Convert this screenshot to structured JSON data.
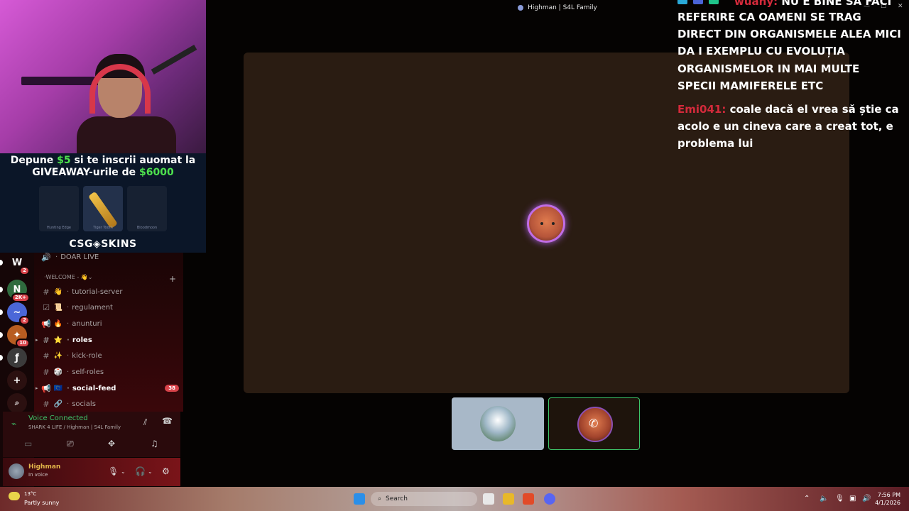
{
  "window": {
    "title": "Highman | S4L Family"
  },
  "stream_overlay": {
    "promo": {
      "line1_pre": "Depune ",
      "line1_amount": "$5",
      "line1_post": " si te inscrii auomat la",
      "line2_pre": "GIVEAWAY-urile de ",
      "line2_amount": "$6000",
      "items": [
        "Hunting Edge",
        "Tiger Tooth",
        "Bloodmoon"
      ],
      "brand": "CSG◈SKINS"
    }
  },
  "server_rail": {
    "servers": [
      {
        "label": "W",
        "badge": "2",
        "color": "#c9c9c9"
      },
      {
        "label": "N",
        "badge": "2K+",
        "color": "#2f6b3e"
      },
      {
        "label": "~",
        "badge": "2",
        "color": "#4b67d8"
      },
      {
        "label": "✦",
        "badge": "10",
        "color": "#b85d21"
      },
      {
        "label": "ƒ",
        "badge": "",
        "color": "#3b3b3b"
      }
    ],
    "add_label": "+",
    "discover_label": "⌕"
  },
  "channels": {
    "top_channel": "DOAR LIVE",
    "category": "WELCOME - 👋",
    "items": [
      {
        "icon": "#",
        "emoji": "👋",
        "name": "tutorial-server",
        "bold": false,
        "badge": ""
      },
      {
        "icon": "☑",
        "emoji": "📜",
        "name": "regulament",
        "bold": false,
        "badge": ""
      },
      {
        "icon": "📢",
        "emoji": "🔥",
        "name": "anunturi",
        "bold": false,
        "badge": ""
      },
      {
        "icon": "#",
        "emoji": "⭐",
        "name": "roles",
        "bold": true,
        "badge": ""
      },
      {
        "icon": "#",
        "emoji": "✨",
        "name": "kick-role",
        "bold": false,
        "badge": ""
      },
      {
        "icon": "#",
        "emoji": "🎲",
        "name": "self-roles",
        "bold": false,
        "badge": ""
      },
      {
        "icon": "📢",
        "emoji": "🇪🇺",
        "name": "social-feed",
        "bold": true,
        "badge": "38"
      },
      {
        "icon": "#",
        "emoji": "🔗",
        "name": "socials",
        "bold": false,
        "badge": ""
      }
    ]
  },
  "voice": {
    "status": "Voice Connected",
    "location": "SHARK 4 LIFE / Highman | S4L Family"
  },
  "user": {
    "name": "Highman",
    "status": "In voice"
  },
  "chat": {
    "messages": [
      {
        "user": "wuany:",
        "text": "NU E BINE SA FACI"
      },
      {
        "user": "",
        "text": "REFERIRE CA OAMENI SE TRAG"
      },
      {
        "user": "",
        "text": "DIRECT DIN ORGANISMELE ALEA MICI"
      },
      {
        "user": "",
        "text": "DA I EXEMPLU CU EVOLUȚIA"
      },
      {
        "user": "",
        "text": "ORGANISMELOR IN MAI MULTE"
      },
      {
        "user": "",
        "text": "SPECII MAMIFERELE ETC"
      },
      {
        "user": "Emi041:",
        "text": "coale dacă el vrea să știe ca"
      },
      {
        "user": "",
        "text": "acolo e un cineva care a creat tot, e"
      },
      {
        "user": "",
        "text": "problema lui"
      }
    ]
  },
  "taskbar": {
    "temperature": "13°C",
    "weather": "Partly sunny",
    "search_placeholder": "Search",
    "time": "7:56 PM",
    "date": "4/1/2026"
  },
  "colors": {
    "accent_green": "#3fc56a",
    "badge_red": "#d8434a",
    "chat_user_red": "#d42a3b",
    "speaking_ring": "#c06de6"
  }
}
